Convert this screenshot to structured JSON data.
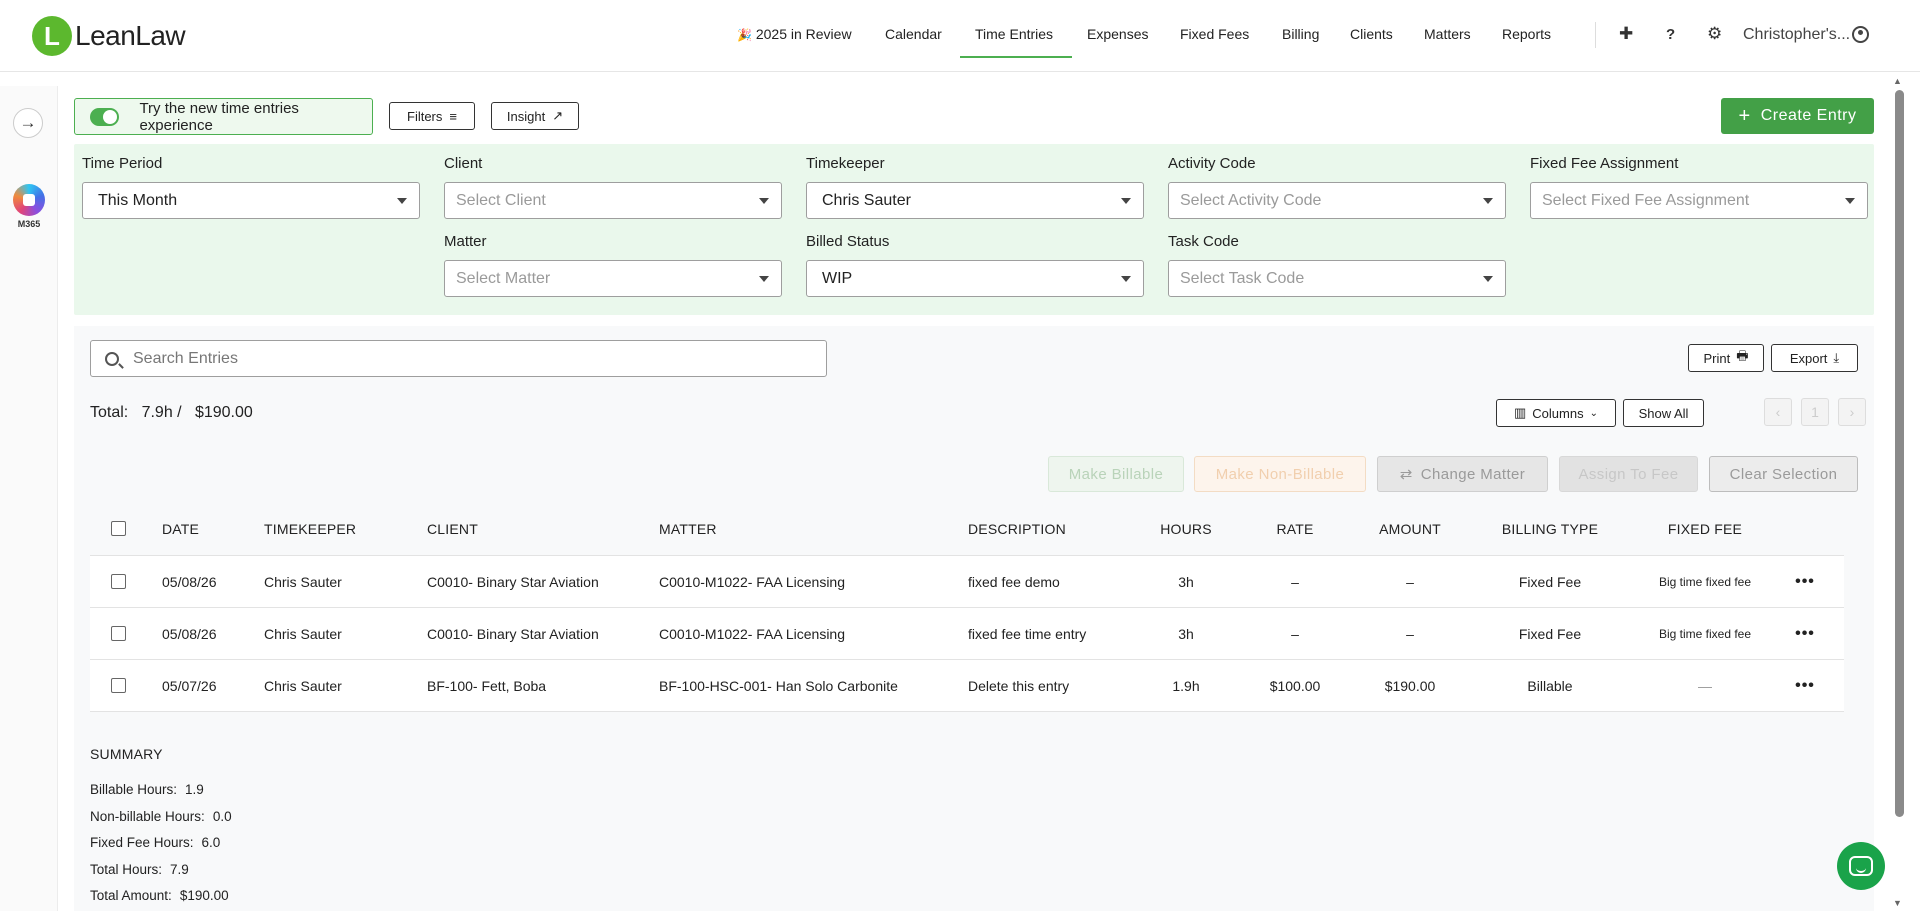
{
  "brand": {
    "logo_letter": "L",
    "name": "LeanLaw",
    "color": "#5cb82e"
  },
  "nav": {
    "items": [
      {
        "label": "2025 in Review",
        "icon": "party-popper-icon",
        "glyph": "🎉"
      },
      {
        "label": "Calendar"
      },
      {
        "label": "Time Entries",
        "active": true
      },
      {
        "label": "Expenses"
      },
      {
        "label": "Fixed Fees"
      },
      {
        "label": "Billing"
      },
      {
        "label": "Clients"
      },
      {
        "label": "Matters"
      },
      {
        "label": "Reports"
      }
    ],
    "plus_glyph": "✚",
    "help_glyph": "?",
    "settings_glyph": "⚙",
    "user_name": "Christopher's...",
    "accent": "#4caf50"
  },
  "rail": {
    "expand_glyph": "→",
    "m365_label": "M365"
  },
  "toolbar": {
    "toggle_label": "Try the new time entries experience",
    "filters_label": "Filters",
    "filters_glyph": "≡",
    "insight_label": "Insight",
    "insight_glyph": "↗",
    "create_label": "Create Entry",
    "create_glyph": "+"
  },
  "filters": {
    "time_period": {
      "label": "Time Period",
      "value": "This Month"
    },
    "client": {
      "label": "Client",
      "placeholder": "Select Client"
    },
    "timekeeper": {
      "label": "Timekeeper",
      "value": "Chris Sauter"
    },
    "activity_code": {
      "label": "Activity Code",
      "placeholder": "Select Activity Code"
    },
    "fixed_fee_assignment": {
      "label": "Fixed Fee Assignment",
      "placeholder": "Select Fixed Fee Assignment"
    },
    "matter": {
      "label": "Matter",
      "placeholder": "Select Matter"
    },
    "billed_status": {
      "label": "Billed Status",
      "value": "WIP"
    },
    "task_code": {
      "label": "Task Code",
      "placeholder": "Select Task Code"
    }
  },
  "entries": {
    "search_placeholder": "Search Entries",
    "print_label": "Print",
    "print_glyph": "🖶",
    "export_label": "Export",
    "export_glyph": "⤓",
    "total_text": "Total:   7.9h /   $190.00",
    "columns_label": "Columns",
    "columns_glyph": "▥",
    "show_all_label": "Show All",
    "page_prev": "‹",
    "page_num": "1",
    "page_next": "›",
    "actions": {
      "make_billable": "Make Billable",
      "make_non_billable": "Make Non-Billable",
      "change_matter": "Change Matter",
      "change_matter_glyph": "⇄",
      "assign_to_fee": "Assign To Fee",
      "clear_selection": "Clear Selection"
    },
    "columns": [
      "DATE",
      "TIMEKEEPER",
      "CLIENT",
      "MATTER",
      "DESCRIPTION",
      "HOURS",
      "RATE",
      "AMOUNT",
      "BILLING TYPE",
      "FIXED FEE"
    ],
    "rows": [
      {
        "date": "05/08/26",
        "timekeeper": "Chris Sauter",
        "client": "C0010- Binary Star Aviation",
        "matter": "C0010-M1022- FAA Licensing",
        "description": "fixed fee demo",
        "hours": "3h",
        "rate": "–",
        "amount": "–",
        "billing_type": "Fixed Fee",
        "fixed_fee": "Big time fixed fee",
        "menu": "•••"
      },
      {
        "date": "05/08/26",
        "timekeeper": "Chris Sauter",
        "client": "C0010- Binary Star Aviation",
        "matter": "C0010-M1022- FAA Licensing",
        "description": "fixed fee time entry",
        "hours": "3h",
        "rate": "–",
        "amount": "–",
        "billing_type": "Fixed Fee",
        "fixed_fee": "Big time fixed fee",
        "menu": "•••"
      },
      {
        "date": "05/07/26",
        "timekeeper": "Chris Sauter",
        "client": "BF-100- Fett, Boba",
        "matter": "BF-100-HSC-001- Han Solo Carbonite",
        "description": "Delete this entry",
        "hours": "1.9h",
        "rate": "$100.00",
        "amount": "$190.00",
        "billing_type": "Billable",
        "fixed_fee": "—",
        "menu": "•••"
      }
    ]
  },
  "summary": {
    "title": "SUMMARY",
    "rows": [
      {
        "label": "Billable Hours:",
        "value": "1.9"
      },
      {
        "label": "Non-billable Hours:",
        "value": "0.0"
      },
      {
        "label": "Fixed Fee Hours:",
        "value": "6.0"
      },
      {
        "label": "Total Hours:",
        "value": "7.9"
      },
      {
        "label": "Total Amount:",
        "value": "$190.00"
      }
    ]
  }
}
